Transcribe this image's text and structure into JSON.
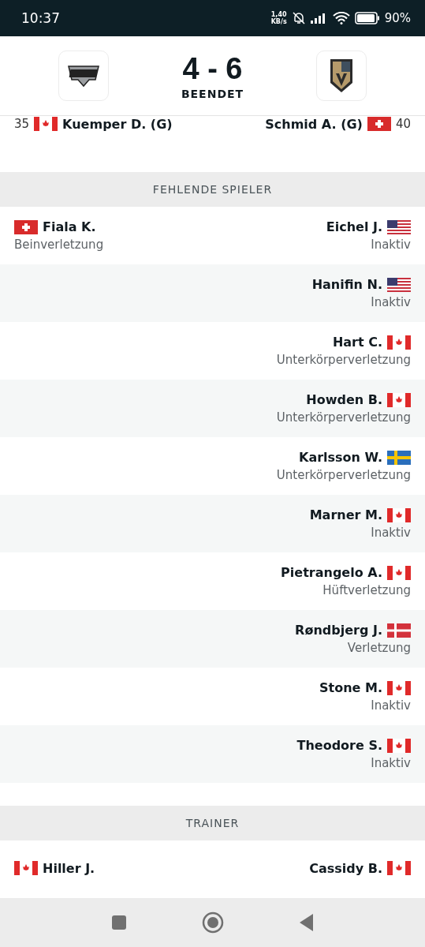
{
  "status_bar": {
    "time": "10:37",
    "net_speed": "1,40",
    "net_unit": "KB/s",
    "battery": "90%"
  },
  "header": {
    "score": "4 - 6",
    "status": "BEENDET"
  },
  "goalies": {
    "left": {
      "number": "35",
      "flag": {
        "kind": "ca"
      },
      "name": "Kuemper D. (G)"
    },
    "right": {
      "number": "40",
      "flag": {
        "kind": "ch"
      },
      "name": "Schmid A. (G)"
    }
  },
  "sections": [
    {
      "title": "FEHLENDE SPIELER",
      "rows": [
        {
          "left": {
            "name": "Fiala K.",
            "flag": {
              "kind": "ch"
            },
            "reason": "Beinverletzung"
          },
          "right": {
            "name": "Eichel J.",
            "flag": {
              "kind": "us"
            },
            "reason": "Inaktiv"
          }
        },
        {
          "right": {
            "name": "Hanifin N.",
            "flag": {
              "kind": "us"
            },
            "reason": "Inaktiv"
          }
        },
        {
          "right": {
            "name": "Hart C.",
            "flag": {
              "kind": "ca"
            },
            "reason": "Unterkörperverletzung"
          }
        },
        {
          "right": {
            "name": "Howden B.",
            "flag": {
              "kind": "ca"
            },
            "reason": "Unterkörperverletzung"
          }
        },
        {
          "right": {
            "name": "Karlsson W.",
            "flag": {
              "kind": "se"
            },
            "reason": "Unterkörperverletzung"
          }
        },
        {
          "right": {
            "name": "Marner M.",
            "flag": {
              "kind": "ca"
            },
            "reason": "Inaktiv"
          }
        },
        {
          "right": {
            "name": "Pietrangelo A.",
            "flag": {
              "kind": "ca"
            },
            "reason": "Hüftverletzung"
          }
        },
        {
          "right": {
            "name": "Røndbjerg J.",
            "flag": {
              "kind": "dk"
            },
            "reason": "Verletzung"
          }
        },
        {
          "right": {
            "name": "Stone M.",
            "flag": {
              "kind": "ca"
            },
            "reason": "Inaktiv"
          }
        },
        {
          "right": {
            "name": "Theodore S.",
            "flag": {
              "kind": "ca"
            },
            "reason": "Inaktiv"
          }
        }
      ]
    },
    {
      "title": "TRAINER",
      "rows": [
        {
          "left": {
            "name": "Hiller J.",
            "flag": {
              "kind": "ca"
            }
          },
          "right": {
            "name": "Cassidy B.",
            "flag": {
              "kind": "ca"
            }
          }
        }
      ]
    }
  ]
}
